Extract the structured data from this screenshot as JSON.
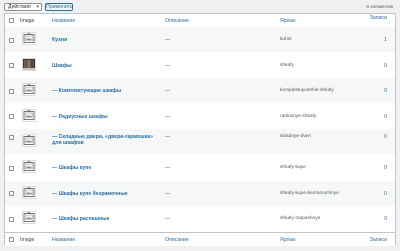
{
  "toolbar": {
    "bulk_actions_label": "Действия",
    "apply_label": "Применить",
    "items_count": "8 элементов"
  },
  "columns": {
    "image": "Image",
    "name": "Название",
    "description": "Описание",
    "slug": "Ярлык",
    "count": "Записи"
  },
  "rows": [
    {
      "name": "Кухни",
      "description": "—",
      "slug": "kuhni",
      "count": "1",
      "thumb": "placeholder"
    },
    {
      "name": "Шкафы",
      "description": "—",
      "slug": "shkafy",
      "count": "0",
      "thumb": "photo"
    },
    {
      "name": "— Комплектующие шкафы",
      "description": "—",
      "slug": "komplektuyushhie-shkafy",
      "count": "0",
      "thumb": "placeholder"
    },
    {
      "name": "— Радиусные шкафы",
      "description": "—",
      "slug": "radiusnye-shkafy",
      "count": "0",
      "thumb": "placeholder"
    },
    {
      "name": "— Складные двери, «двери-гармошка» для шкафов",
      "description": "—",
      "slug": "skladnye-dveri",
      "count": "0",
      "thumb": "placeholder"
    },
    {
      "name": "— Шкафы купе",
      "description": "—",
      "slug": "shkafy-kupe",
      "count": "0",
      "thumb": "placeholder"
    },
    {
      "name": "— Шкафы купе безрамочные",
      "description": "—",
      "slug": "shkafy-kupe-bezramochnye",
      "count": "0",
      "thumb": "placeholder"
    },
    {
      "name": "— Шкафы распашные",
      "description": "—",
      "slug": "shkafy-raspashnye",
      "count": "0",
      "thumb": "placeholder"
    }
  ],
  "colors": {
    "link": "#2271b1",
    "border": "#c3c4c7",
    "stripe": "#f6f7f7"
  }
}
